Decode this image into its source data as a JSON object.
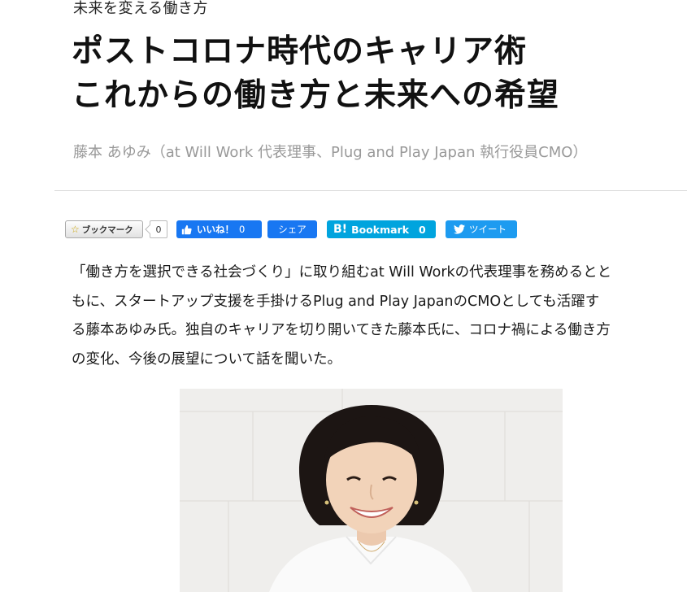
{
  "article": {
    "kicker": "未来を変える働き方",
    "title_line1": "ポストコロナ時代のキャリア術",
    "title_line2": "これからの働き方と未来への希望",
    "byline": "藤本 あゆみ（at Will Work 代表理事、Plug and Play Japan 執行役員CMO）",
    "lead_line1": "「働き方を選択できる社会づくり」に取り組むat Will Workの代表理事を務めるとと",
    "lead_line2": "もに、スタートアップ支援を手掛けるPlug and Play JapanのCMOとしても活躍す",
    "lead_line3": "る藤本あゆみ氏。独自のキャリアを切り開いてきた藤本氏に、コロナ禍による働き方",
    "lead_line4": "の変化、今後の展望について話を聞いた。"
  },
  "share": {
    "bookmark_label": "ブックマーク",
    "bookmark_count": "0",
    "like_label": "いいね！",
    "like_count": "0",
    "share_label": "シェア",
    "hatena_mark": "B!",
    "hatena_label": "Bookmark",
    "hatena_count": "0",
    "tweet_label": "ツイート"
  },
  "icons": {
    "star": "star-icon",
    "thumb": "thumbs-up-icon",
    "bird": "twitter-bird-icon"
  },
  "colors": {
    "facebook": "#1877f2",
    "hatena": "#00a4de",
    "twitter": "#1d9bf0",
    "byline": "#999999"
  }
}
